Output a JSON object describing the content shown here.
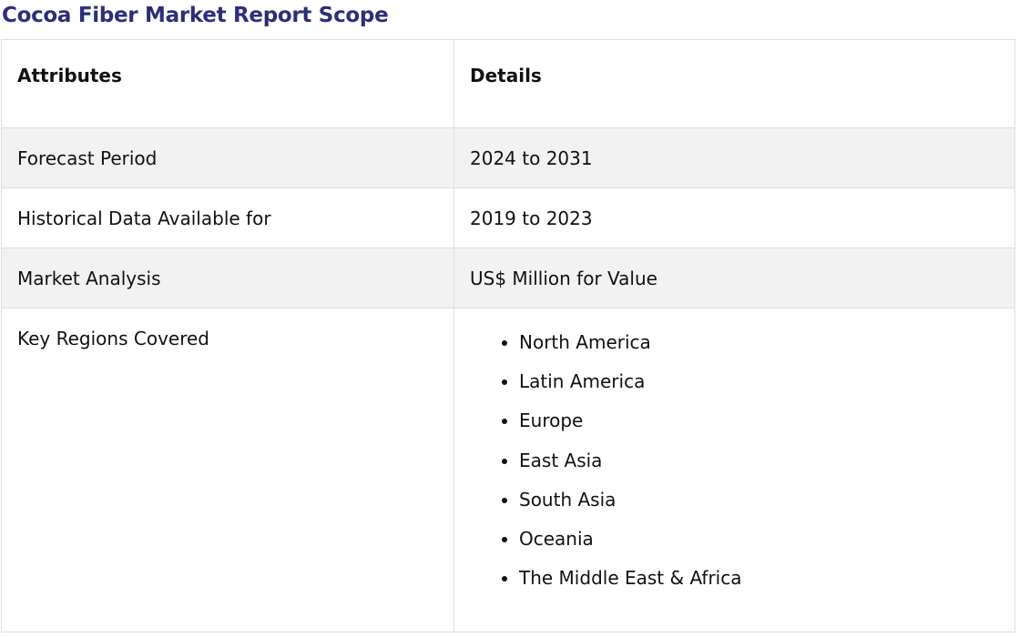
{
  "title": "Cocoa Fiber Market Report Scope",
  "table": {
    "headers": [
      "Attributes",
      "Details"
    ],
    "rows": [
      {
        "attribute": "Forecast Period",
        "detail": "2024 to 2031"
      },
      {
        "attribute": "Historical Data Available for",
        "detail": "2019 to 2023"
      },
      {
        "attribute": "Market Analysis",
        "detail": "US$ Million for Value"
      },
      {
        "attribute": "Key Regions Covered",
        "regions": [
          "North America",
          "Latin America",
          "Europe",
          "East Asia",
          "South Asia",
          "Oceania",
          "The Middle East & Africa"
        ]
      }
    ]
  },
  "colors": {
    "title": "#2b2f7a",
    "row_shade": "#f2f2f2",
    "border": "#dedede"
  }
}
